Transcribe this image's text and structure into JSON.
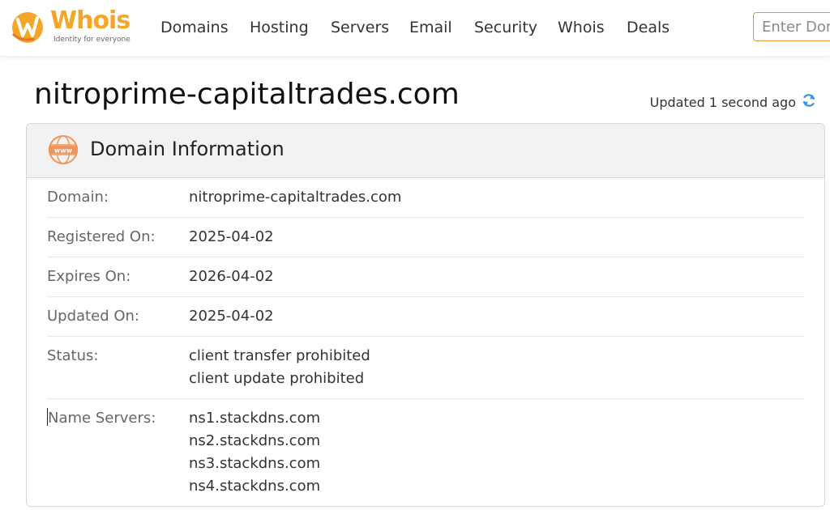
{
  "header": {
    "logo_text": "Whois",
    "logo_tagline": "Identity for everyone",
    "nav": [
      "Domains",
      "Hosting",
      "Servers",
      "Email",
      "Security",
      "Whois",
      "Deals"
    ],
    "search_placeholder": "Enter Domain"
  },
  "page": {
    "title": "nitroprime-capitaltrades.com",
    "updated": "Updated 1 second ago"
  },
  "card": {
    "title": "Domain Information",
    "rows": [
      {
        "label": "Domain:",
        "values": [
          "nitroprime-capitaltrades.com"
        ]
      },
      {
        "label": "Registered On:",
        "values": [
          "2025-04-02"
        ]
      },
      {
        "label": "Expires On:",
        "values": [
          "2026-04-02"
        ]
      },
      {
        "label": "Updated On:",
        "values": [
          "2025-04-02"
        ]
      },
      {
        "label": "Status:",
        "values": [
          "client transfer prohibited",
          "client update prohibited"
        ]
      },
      {
        "label": "Name Servers:",
        "values": [
          "ns1.stackdns.com",
          "ns2.stackdns.com",
          "ns3.stackdns.com",
          "ns4.stackdns.com"
        ]
      }
    ]
  },
  "colors": {
    "brand_orange": "#f4a62a",
    "refresh_blue": "#3a8ee6",
    "input_border": "#e6943a"
  },
  "icons": {
    "logo": "whois-logo-icon",
    "refresh": "refresh-icon",
    "www": "www-globe-icon"
  }
}
